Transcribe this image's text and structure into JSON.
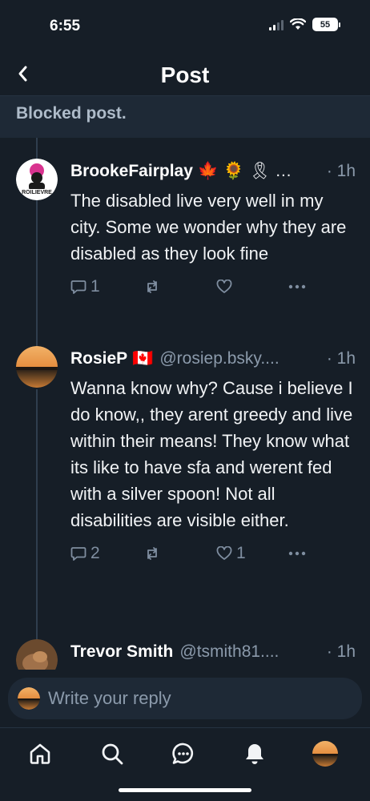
{
  "status": {
    "time": "6:55",
    "battery": "55"
  },
  "header": {
    "title": "Post"
  },
  "blocked": {
    "label": "Blocked post."
  },
  "posts": [
    {
      "author": "BrookeFairplay",
      "handle": "",
      "flair": "🍁 🌻 🎗 …",
      "time": "· 1h",
      "text": "The disabled live very well in my city. Some we wonder why they are disabled as they look fine",
      "replies": "1",
      "reposts": "",
      "likes": ""
    },
    {
      "author": "RosieP",
      "handle": "@rosiep.bsky....",
      "flair": "🇨🇦",
      "time": "· 1h",
      "text": "Wanna know why? Cause i believe I do know,, they arent greedy and live within their means! They know what its like to have sfa and werent fed with a silver spoon!  Not all disabilities are visible either.",
      "replies": "2",
      "reposts": "",
      "likes": "1"
    },
    {
      "author": "Trevor Smith",
      "handle": "@tsmith81....",
      "flair": "",
      "time": "· 1h"
    }
  ],
  "reply": {
    "placeholder": "Write your reply"
  },
  "colors": {
    "background": "#161e27",
    "accent": "#1083fe",
    "muted": "#8b9aab"
  }
}
